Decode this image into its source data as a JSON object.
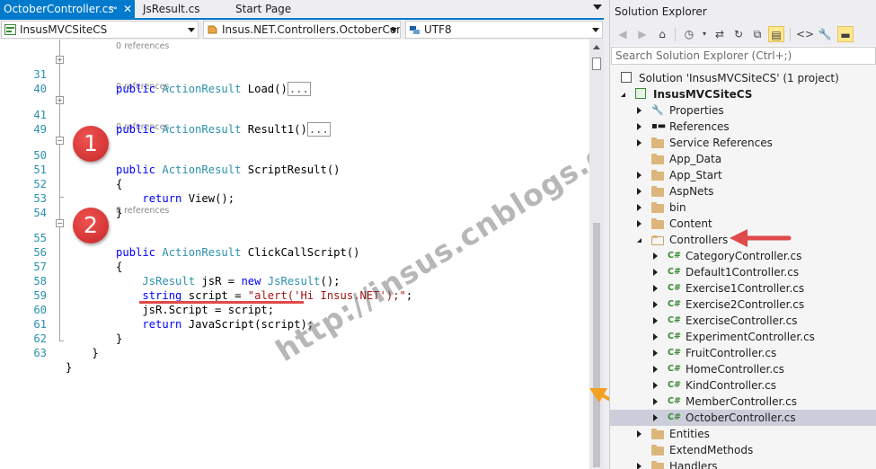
{
  "tabs": [
    {
      "label": "OctoberController.cs",
      "active": true
    },
    {
      "label": "JsResult.cs",
      "active": false
    },
    {
      "label": "Start Page",
      "active": false
    }
  ],
  "navbar": {
    "project": "InsusMVCSiteCS",
    "type": "Insus.NET.Controllers.OctoberCont",
    "member": "UTF8"
  },
  "code_lines": [
    {
      "kind": "refs",
      "text": "0 references"
    },
    {
      "kind": "code",
      "num": "31",
      "parts": [
        [
          "kw",
          "public "
        ],
        [
          "ty",
          "ActionResult"
        ],
        [
          "tx",
          " Load()"
        ]
      ],
      "collapsed": "..."
    },
    {
      "kind": "code",
      "num": "40",
      "parts": []
    },
    {
      "kind": "refs",
      "text": "0 references"
    },
    {
      "kind": "code",
      "num": "41",
      "parts": [
        [
          "kw",
          "public "
        ],
        [
          "ty",
          "ActionResult"
        ],
        [
          "tx",
          " Result1()"
        ]
      ],
      "collapsed": "..."
    },
    {
      "kind": "code",
      "num": "49",
      "parts": []
    },
    {
      "kind": "refs",
      "text": "0 references"
    },
    {
      "kind": "code",
      "num": "50",
      "parts": [
        [
          "kw",
          "public "
        ],
        [
          "ty",
          "ActionResult"
        ],
        [
          "tx",
          " ScriptResult()"
        ]
      ]
    },
    {
      "kind": "code",
      "num": "51",
      "parts": [
        [
          "tx",
          "{"
        ]
      ]
    },
    {
      "kind": "code",
      "num": "52",
      "parts": [
        [
          "tx",
          "    "
        ],
        [
          "kw",
          "return"
        ],
        [
          "tx",
          " View();"
        ]
      ]
    },
    {
      "kind": "code",
      "num": "53",
      "parts": [
        [
          "tx",
          "}"
        ]
      ]
    },
    {
      "kind": "code",
      "num": "54",
      "parts": []
    },
    {
      "kind": "refs",
      "text": "0 references"
    },
    {
      "kind": "code",
      "num": "55",
      "parts": [
        [
          "kw",
          "public "
        ],
        [
          "ty",
          "ActionResult"
        ],
        [
          "tx",
          " ClickCallScript()"
        ]
      ]
    },
    {
      "kind": "code",
      "num": "56",
      "parts": [
        [
          "tx",
          "{"
        ]
      ]
    },
    {
      "kind": "code",
      "num": "57",
      "parts": [
        [
          "tx",
          "    "
        ],
        [
          "ty",
          "JsResult"
        ],
        [
          "tx",
          " jsR = "
        ],
        [
          "kw",
          "new "
        ],
        [
          "ty",
          "JsResult"
        ],
        [
          "tx",
          "();"
        ]
      ]
    },
    {
      "kind": "code",
      "num": "58",
      "parts": [
        [
          "tx",
          "    "
        ],
        [
          "kw",
          "string"
        ],
        [
          "tx",
          " script = "
        ],
        [
          "st",
          "\"alert('Hi Insus.NET');\""
        ],
        [
          "tx",
          ";"
        ]
      ]
    },
    {
      "kind": "code",
      "num": "59",
      "parts": [
        [
          "tx",
          "    jsR.Script = script;"
        ]
      ]
    },
    {
      "kind": "code",
      "num": "60",
      "parts": [
        [
          "tx",
          "    "
        ],
        [
          "kw",
          "return"
        ],
        [
          "tx",
          " JavaScript(script);"
        ]
      ]
    },
    {
      "kind": "code",
      "num": "61",
      "parts": [
        [
          "tx",
          "}"
        ]
      ]
    },
    {
      "kind": "code",
      "num": "62",
      "parts": [
        [
          "tx",
          "    }"
        ]
      ]
    },
    {
      "kind": "code",
      "num": "63",
      "parts": [
        [
          "tx",
          "}"
        ]
      ]
    }
  ],
  "markers": [
    "1",
    "2"
  ],
  "watermark": "http://insus.cnblogs.com",
  "solution_explorer": {
    "title": "Solution Explorer",
    "search_placeholder": "Search Solution Explorer (Ctrl+;)",
    "tree": [
      {
        "label": "Solution 'InsusMVCSiteCS' (1 project)",
        "level": 0,
        "icon": "solution-icon",
        "expander": "none",
        "bold": false
      },
      {
        "label": "InsusMVCSiteCS",
        "level": 1,
        "icon": "project-icon",
        "expander": "open",
        "bold": true
      },
      {
        "label": "Properties",
        "level": 2,
        "icon": "wrench-icon",
        "expander": "closed"
      },
      {
        "label": "References",
        "level": 2,
        "icon": "references-icon",
        "expander": "closed"
      },
      {
        "label": "Service References",
        "level": 2,
        "icon": "folder-icon",
        "expander": "closed"
      },
      {
        "label": "App_Data",
        "level": 2,
        "icon": "folder-icon",
        "expander": "none"
      },
      {
        "label": "App_Start",
        "level": 2,
        "icon": "folder-icon",
        "expander": "closed"
      },
      {
        "label": "AspNets",
        "level": 2,
        "icon": "folder-icon",
        "expander": "closed"
      },
      {
        "label": "bin",
        "level": 2,
        "icon": "folder-icon",
        "expander": "closed"
      },
      {
        "label": "Content",
        "level": 2,
        "icon": "folder-icon",
        "expander": "closed"
      },
      {
        "label": "Controllers",
        "level": 2,
        "icon": "folder-open-icon",
        "expander": "open"
      },
      {
        "label": "CategoryController.cs",
        "level": 3,
        "icon": "csharp-file-icon",
        "expander": "closed"
      },
      {
        "label": "Default1Controller.cs",
        "level": 3,
        "icon": "csharp-file-icon",
        "expander": "closed"
      },
      {
        "label": "Exercise1Controller.cs",
        "level": 3,
        "icon": "csharp-file-icon",
        "expander": "closed"
      },
      {
        "label": "Exercise2Controller.cs",
        "level": 3,
        "icon": "csharp-file-icon",
        "expander": "closed"
      },
      {
        "label": "ExerciseController.cs",
        "level": 3,
        "icon": "csharp-file-icon",
        "expander": "closed"
      },
      {
        "label": "ExperimentController.cs",
        "level": 3,
        "icon": "csharp-file-icon",
        "expander": "closed"
      },
      {
        "label": "FruitController.cs",
        "level": 3,
        "icon": "csharp-file-icon",
        "expander": "closed"
      },
      {
        "label": "HomeController.cs",
        "level": 3,
        "icon": "csharp-file-icon",
        "expander": "closed"
      },
      {
        "label": "KindController.cs",
        "level": 3,
        "icon": "csharp-file-icon",
        "expander": "closed"
      },
      {
        "label": "MemberController.cs",
        "level": 3,
        "icon": "csharp-file-icon",
        "expander": "closed"
      },
      {
        "label": "OctoberController.cs",
        "level": 3,
        "icon": "csharp-file-icon",
        "expander": "closed",
        "selected": true
      },
      {
        "label": "Entities",
        "level": 2,
        "icon": "folder-icon",
        "expander": "closed"
      },
      {
        "label": "ExtendMethods",
        "level": 2,
        "icon": "folder-icon",
        "expander": "none"
      },
      {
        "label": "Handlers",
        "level": 2,
        "icon": "folder-icon",
        "expander": "closed"
      }
    ]
  },
  "colors": {
    "accent": "#007acc",
    "keyword": "#0000ff",
    "type": "#2b91af",
    "string": "#a31515",
    "marker_red": "#d32f2f",
    "arrow_red": "#e04a4a",
    "arrow_orange": "#f5a020",
    "selection": "#cccedb"
  }
}
